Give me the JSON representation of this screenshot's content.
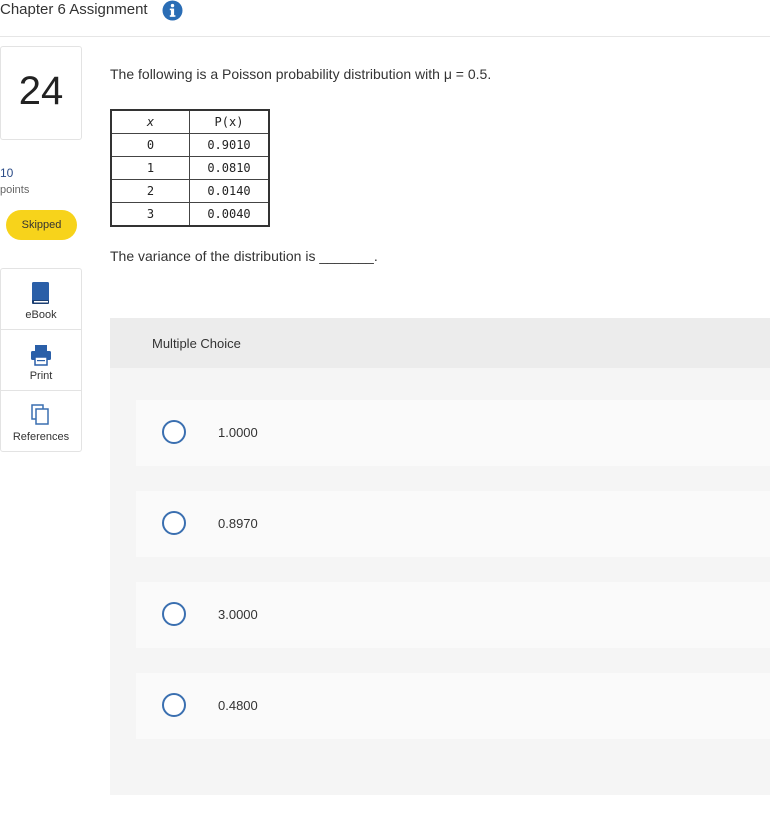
{
  "header": {
    "title": "Chapter 6 Assignment",
    "info_icon": "info-icon"
  },
  "question": {
    "number": "24",
    "points_value": "10",
    "points_label": "points",
    "status": "Skipped"
  },
  "tools": [
    {
      "label": "eBook",
      "icon": "book-icon"
    },
    {
      "label": "Print",
      "icon": "printer-icon"
    },
    {
      "label": "References",
      "icon": "references-icon"
    }
  ],
  "prompt": "The following is a Poisson probability distribution with μ = 0.5.",
  "table": {
    "headers": [
      "x",
      "P(x)"
    ],
    "rows": [
      [
        "0",
        "0.9010"
      ],
      [
        "1",
        "0.0810"
      ],
      [
        "2",
        "0.0140"
      ],
      [
        "3",
        "0.0040"
      ]
    ]
  },
  "variance_text": "The variance of the distribution is _______.",
  "multiple_choice": {
    "title": "Multiple Choice",
    "options": [
      "1.0000",
      "0.8970",
      "3.0000",
      "0.4800"
    ]
  },
  "colors": {
    "accent": "#3a6fb0",
    "skipped_badge": "#f7d31b"
  }
}
